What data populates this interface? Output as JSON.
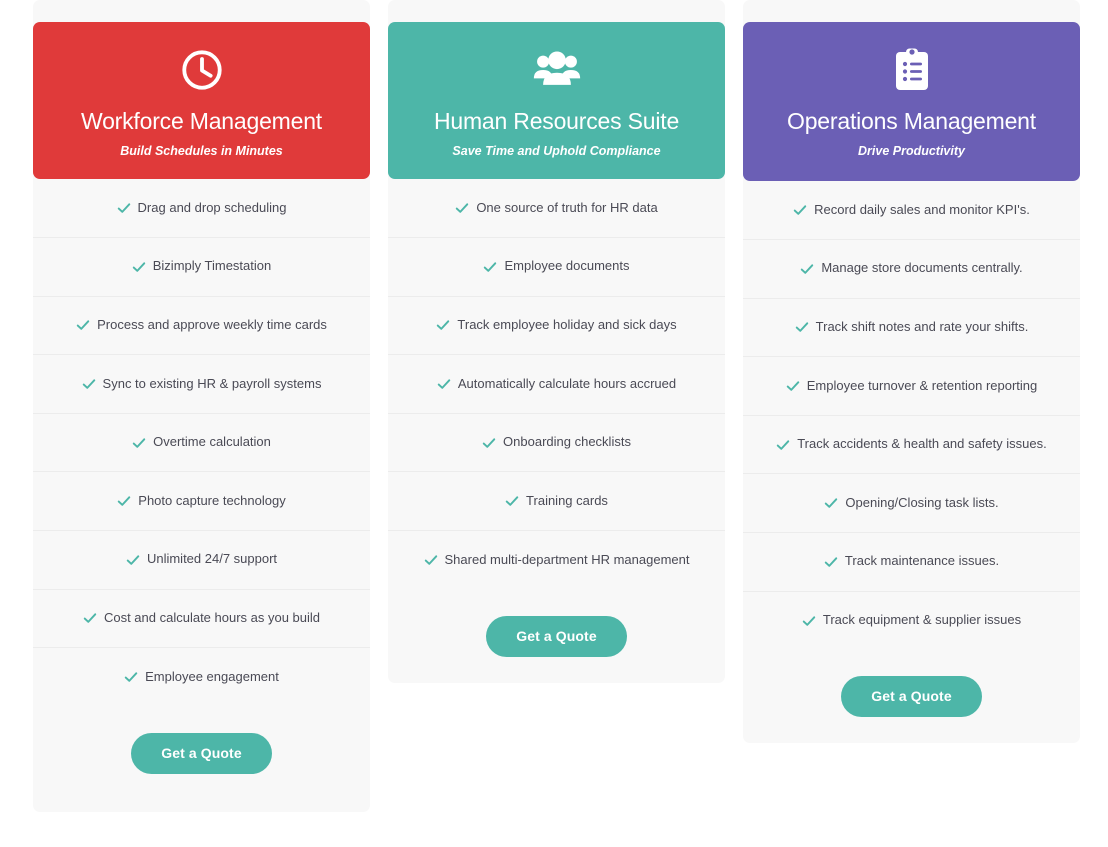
{
  "page": {
    "background": "#ffffff",
    "accent_teal": "#4db6a8",
    "check_color": "#4db6a8",
    "divider_color": "#ececec",
    "card_body_background": "#f8f8f8",
    "body_text_color": "#4a4a55"
  },
  "cards": [
    {
      "id": "workforce-management",
      "title": "Workforce Management",
      "subtitle": "Build Schedules in Minutes",
      "header_color": "#e03a3a",
      "icon": "clock-icon",
      "features": [
        "Drag and drop scheduling",
        "Bizimply Timestation",
        "Process and approve weekly time cards",
        "Sync to existing HR & payroll systems",
        "Overtime calculation",
        "Photo capture technology",
        "Unlimited 24/7 support",
        "Cost and calculate hours as you build",
        "Employee engagement"
      ],
      "cta_label": "Get a Quote"
    },
    {
      "id": "human-resources-suite",
      "title": "Human Resources Suite",
      "subtitle": "Save Time and Uphold Compliance",
      "header_color": "#4db6a8",
      "icon": "people-group-icon",
      "features": [
        "One source of truth for HR data",
        "Employee documents",
        "Track employee holiday and sick days",
        "Automatically calculate hours accrued",
        "Onboarding checklists",
        "Training cards",
        "Shared multi-department HR management"
      ],
      "cta_label": "Get a Quote"
    },
    {
      "id": "operations-management",
      "title": "Operations Management",
      "subtitle": "Drive Productivity",
      "header_color": "#6b5fb5",
      "icon": "clipboard-list-icon",
      "features": [
        "Record daily sales and monitor KPI's.",
        "Manage store documents centrally.",
        "Track shift notes and rate your shifts.",
        "Employee turnover & retention reporting",
        "Track accidents & health and safety issues.",
        "Opening/Closing task lists.",
        "Track maintenance issues.",
        "Track equipment & supplier issues"
      ],
      "cta_label": "Get a Quote"
    }
  ]
}
